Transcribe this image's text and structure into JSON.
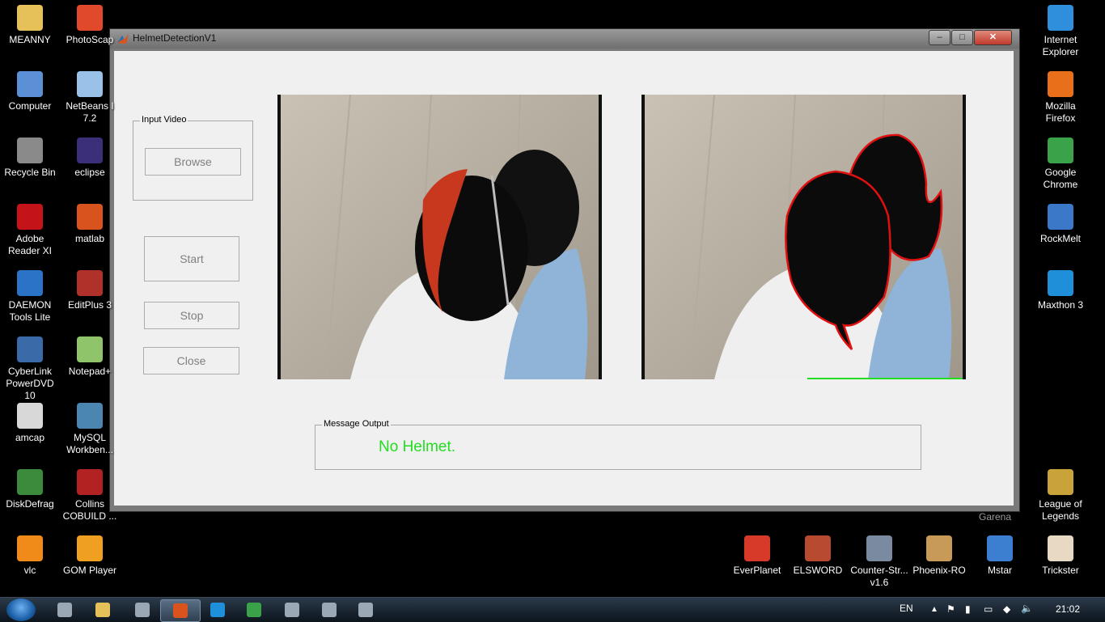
{
  "desktop": {
    "left_icons": [
      {
        "label": "MEANNY",
        "icon": "folder-icon"
      },
      {
        "label": "Computer",
        "icon": "computer-icon"
      },
      {
        "label": "Recycle Bin",
        "icon": "recycle-bin-icon"
      },
      {
        "label": "Adobe\nReader XI",
        "icon": "adobe-reader-icon"
      },
      {
        "label": "DAEMON\nTools Lite",
        "icon": "daemon-tools-icon"
      },
      {
        "label": "CyberLink\nPowerDVD 10",
        "icon": "powerdvd-icon"
      },
      {
        "label": "amcap",
        "icon": "amcap-icon"
      },
      {
        "label": "DiskDefrag",
        "icon": "diskdefrag-icon"
      },
      {
        "label": "vlc",
        "icon": "vlc-icon"
      }
    ],
    "second_icons": [
      {
        "label": "PhotoScap",
        "icon": "photoscape-icon"
      },
      {
        "label": "NetBeans I\n7.2",
        "icon": "netbeans-icon"
      },
      {
        "label": "eclipse",
        "icon": "eclipse-icon"
      },
      {
        "label": "matlab",
        "icon": "matlab-icon"
      },
      {
        "label": "EditPlus 3",
        "icon": "editplus-icon"
      },
      {
        "label": "Notepad+",
        "icon": "notepadpp-icon"
      },
      {
        "label": "MySQL\nWorkben...",
        "icon": "mysql-workbench-icon"
      },
      {
        "label": "Collins\nCOBUILD ...",
        "icon": "collins-icon"
      },
      {
        "label": "GOM Player",
        "icon": "gom-player-icon"
      }
    ],
    "right_icons": [
      {
        "label": "Internet\nExplorer",
        "icon": "internet-explorer-icon"
      },
      {
        "label": "Mozilla\nFirefox",
        "icon": "firefox-icon"
      },
      {
        "label": "Google\nChrome",
        "icon": "chrome-icon"
      },
      {
        "label": "RockMelt",
        "icon": "rockmelt-icon"
      },
      {
        "label": "Maxthon 3",
        "icon": "maxthon-icon"
      },
      {
        "label": "League of\nLegends",
        "icon": "league-of-legends-icon"
      },
      {
        "label": "Trickster",
        "icon": "trickster-icon"
      }
    ],
    "bottom_icons": [
      {
        "label": "EverPlanet",
        "icon": "everplanet-icon"
      },
      {
        "label": "ELSWORD",
        "icon": "elsword-icon"
      },
      {
        "label": "Counter-Str...\nv1.6",
        "icon": "counter-strike-icon"
      },
      {
        "label": "Phoenix-RO",
        "icon": "phoenix-ro-icon"
      },
      {
        "label": "Mstar",
        "icon": "mstar-icon"
      }
    ],
    "garena_label": "Garena"
  },
  "window": {
    "title": "HelmetDetectionV1",
    "minimize": "–",
    "maximize": "□",
    "close": "✕"
  },
  "app": {
    "input_video": {
      "title": "Input Video",
      "browse_label": "Browse"
    },
    "start_label": "Start",
    "stop_label": "Stop",
    "close_label": "Close",
    "message_output": {
      "title": "Message Output",
      "text": "No Helmet.",
      "text_color": "#22dd22"
    }
  },
  "taskbar": {
    "language": "EN",
    "time": "21:02",
    "items": [
      "explorer-icon",
      "folder-icon",
      "app-red-icon",
      "matlab-icon",
      "maxthon-icon",
      "chrome-icon",
      "notepad-icon",
      "paint-icon",
      "game-icon"
    ]
  },
  "colors": {
    "contour": "#e01010",
    "accent_green": "#22dd22"
  }
}
